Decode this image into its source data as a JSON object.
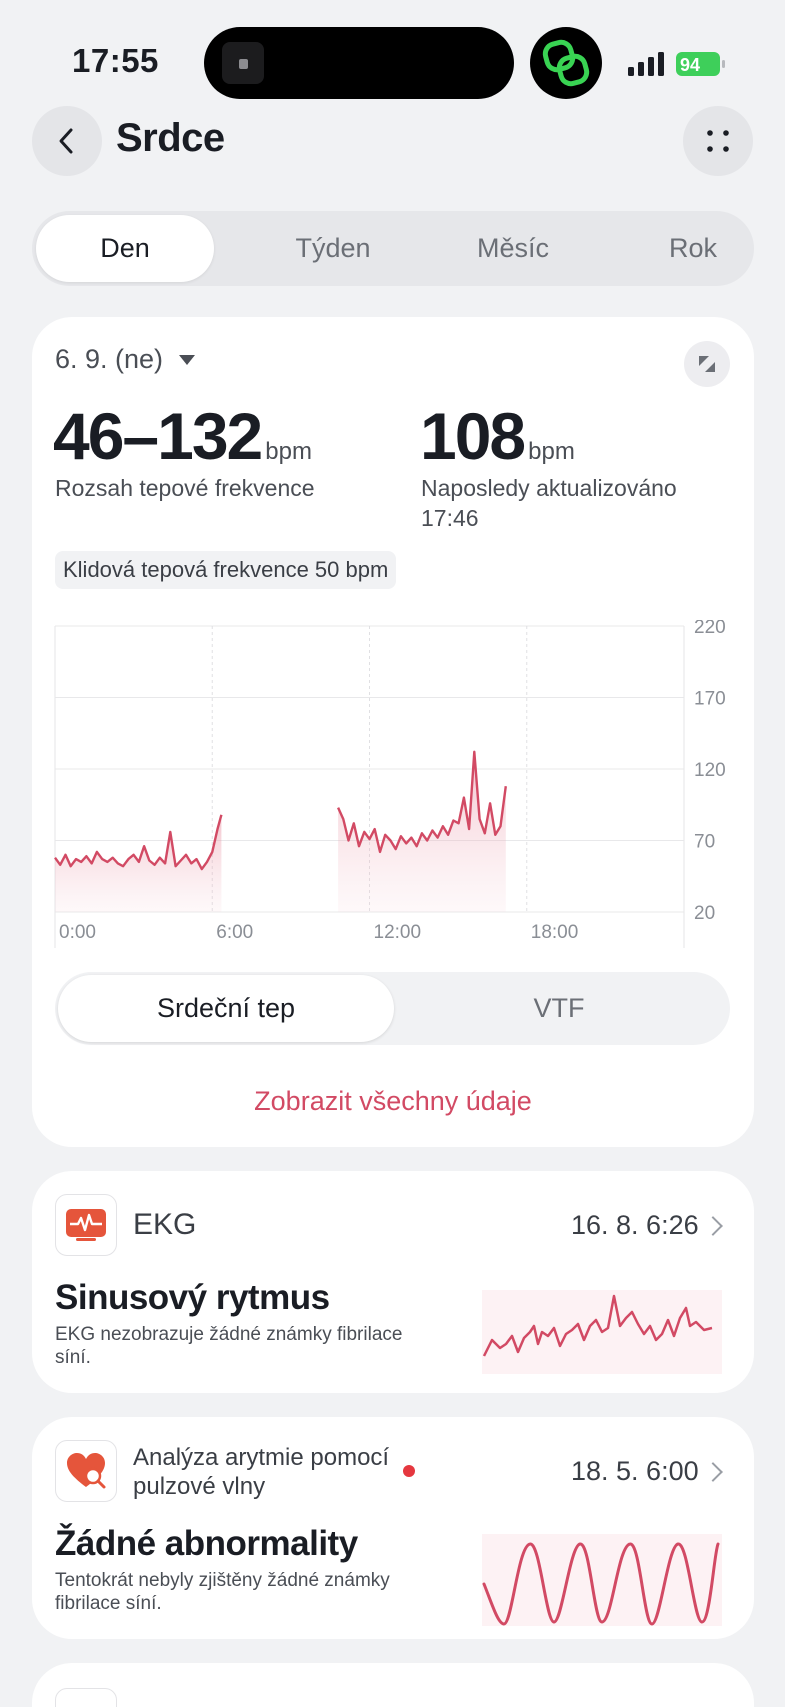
{
  "status": {
    "time": "17:55",
    "battery": "94"
  },
  "header": {
    "title": "Srdce"
  },
  "tabs": [
    {
      "label": "Den",
      "active": true
    },
    {
      "label": "Týden",
      "active": false
    },
    {
      "label": "Měsíc",
      "active": false
    },
    {
      "label": "Rok",
      "active": false
    }
  ],
  "summary": {
    "date": "6. 9. (ne)",
    "range_value": "46–132",
    "range_unit": "bpm",
    "range_label": "Rozsah tepové frekvence",
    "latest_value": "108",
    "latest_unit": "bpm",
    "latest_label": "Naposledy aktualizováno",
    "latest_time": "17:46",
    "resting_pill": "Klidová tepová frekvence 50 bpm"
  },
  "chart_data": {
    "type": "area",
    "x_tick_labels": [
      "0:00",
      "6:00",
      "12:00",
      "18:00"
    ],
    "y_tick_labels": [
      "220",
      "170",
      "120",
      "70",
      "20"
    ],
    "xlim": [
      0,
      24
    ],
    "ylim": [
      20,
      220
    ],
    "color": "#d24a64",
    "grid": true,
    "segments": [
      {
        "x": [
          0.0,
          0.2,
          0.4,
          0.6,
          0.8,
          1.0,
          1.2,
          1.4,
          1.6,
          1.8,
          2.0,
          2.2,
          2.4,
          2.6,
          2.8,
          3.0,
          3.2,
          3.4,
          3.6,
          3.8,
          4.0,
          4.2,
          4.4,
          4.6,
          4.8,
          5.0,
          5.2,
          5.4,
          5.6,
          5.8,
          6.0,
          6.2,
          6.35
        ],
        "y": [
          58,
          53,
          60,
          52,
          57,
          55,
          59,
          54,
          62,
          57,
          55,
          58,
          54,
          52,
          57,
          60,
          55,
          66,
          56,
          53,
          58,
          54,
          76,
          52,
          56,
          60,
          54,
          57,
          50,
          55,
          62,
          78,
          88
        ]
      },
      {
        "x": [
          10.8,
          11.0,
          11.2,
          11.4,
          11.6,
          11.8,
          12.0,
          12.2,
          12.4,
          12.6,
          12.8,
          13.0,
          13.2,
          13.4,
          13.6,
          13.8,
          14.0,
          14.2,
          14.4,
          14.6,
          14.8,
          15.0,
          15.2,
          15.4,
          15.6,
          15.8,
          16.0,
          16.2,
          16.4,
          16.6,
          16.8,
          17.0,
          17.2
        ],
        "y": [
          93,
          85,
          70,
          82,
          66,
          76,
          71,
          78,
          62,
          74,
          70,
          64,
          73,
          68,
          72,
          66,
          75,
          70,
          77,
          72,
          80,
          74,
          84,
          82,
          100,
          78,
          132,
          85,
          75,
          96,
          74,
          80,
          108
        ]
      }
    ]
  },
  "toggle": {
    "left": "Srdeční tep",
    "right": "VTF"
  },
  "link_all": "Zobrazit všechny údaje",
  "ekg": {
    "title": "EKG",
    "date": "16. 8. 6:26",
    "headline": "Sinusový rytmus",
    "desc": "EKG nezobrazuje žádné známky fibrilace síní."
  },
  "arrhythmia": {
    "title": "Analýza arytmie pomocí pulzové vlny",
    "date": "18. 5. 6:00",
    "headline": "Žádné abnormality",
    "desc": "Tentokrát nebyly zjištěny žádné známky fibrilace síní."
  }
}
